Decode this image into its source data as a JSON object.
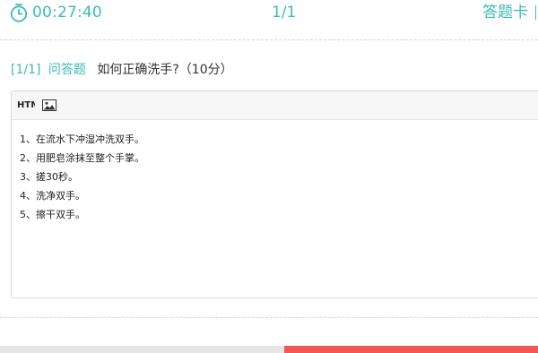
{
  "header": {
    "timer": "00:27:40",
    "progress": "1/1",
    "answer_card_label": "答题卡"
  },
  "question": {
    "index": "[1/1]",
    "type": "问答题",
    "text": "如何正确洗手?（10分）"
  },
  "editor": {
    "toolbar": {
      "html_label": "HTML",
      "image_icon": "image-icon"
    },
    "lines": [
      "1、在流水下冲湿冲洗双手。",
      "2、用肥皂涂抹至整个手掌。",
      "3、搓30秒。",
      "4、洗净双手。",
      "5、擦干双手。"
    ]
  },
  "colors": {
    "accent": "#3cbcb4",
    "submit": "#f25656"
  }
}
